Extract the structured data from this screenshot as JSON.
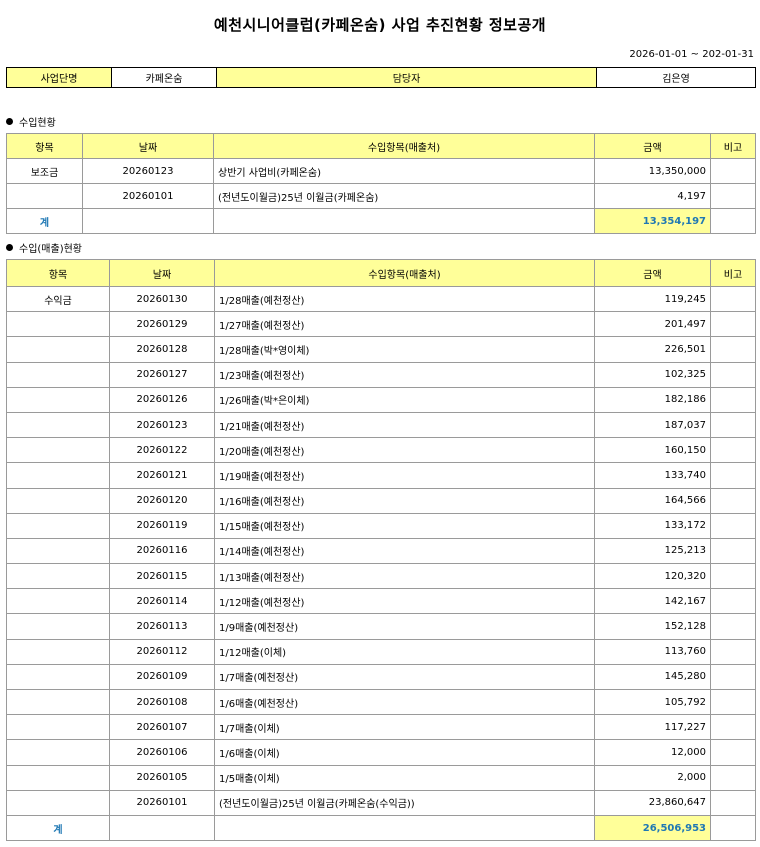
{
  "title": "예천시니어클럽(카페온숨) 사업 추진현황 정보공개",
  "period": "2026-01-01 ~ 202-01-31",
  "info": {
    "label_business": "사업단명",
    "business": "카페온숨",
    "label_manager": "담당자",
    "manager": "김은영"
  },
  "income": {
    "section": "수입현황",
    "headers": [
      "항목",
      "날짜",
      "수입항목(매출처)",
      "금액",
      "비고"
    ],
    "rows": [
      {
        "cat": "보조금",
        "date": "20260123",
        "desc": "상반기 사업비(카페온숨)",
        "amount": "13,350,000",
        "note": ""
      },
      {
        "cat": "",
        "date": "20260101",
        "desc": "(전년도이월금)25년 이월금(카페온숨)",
        "amount": "4,197",
        "note": ""
      }
    ],
    "total_label": "계",
    "total": "13,354,197"
  },
  "sales": {
    "section": "수입(매출)현황",
    "headers": [
      "항목",
      "날짜",
      "수입항목(매출처)",
      "금액",
      "비고"
    ],
    "rows": [
      {
        "cat": "수익금",
        "date": "20260130",
        "desc": "1/28매출(예천정산)",
        "amount": "119,245"
      },
      {
        "cat": "",
        "date": "20260129",
        "desc": "1/27매출(예천정산)",
        "amount": "201,497"
      },
      {
        "cat": "",
        "date": "20260128",
        "desc": "1/28매출(박*영이체)",
        "amount": "226,501"
      },
      {
        "cat": "",
        "date": "20260127",
        "desc": "1/23매출(예천정산)",
        "amount": "102,325"
      },
      {
        "cat": "",
        "date": "20260126",
        "desc": "1/26매출(박*은이체)",
        "amount": "182,186"
      },
      {
        "cat": "",
        "date": "20260123",
        "desc": "1/21매출(예천정산)",
        "amount": "187,037"
      },
      {
        "cat": "",
        "date": "20260122",
        "desc": "1/20매출(예천정산)",
        "amount": "160,150"
      },
      {
        "cat": "",
        "date": "20260121",
        "desc": "1/19매출(예천정산)",
        "amount": "133,740"
      },
      {
        "cat": "",
        "date": "20260120",
        "desc": "1/16매출(예천정산)",
        "amount": "164,566"
      },
      {
        "cat": "",
        "date": "20260119",
        "desc": "1/15매출(예천정산)",
        "amount": "133,172"
      },
      {
        "cat": "",
        "date": "20260116",
        "desc": "1/14매출(예천정산)",
        "amount": "125,213"
      },
      {
        "cat": "",
        "date": "20260115",
        "desc": "1/13매출(예천정산)",
        "amount": "120,320"
      },
      {
        "cat": "",
        "date": "20260114",
        "desc": "1/12매출(예천정산)",
        "amount": "142,167"
      },
      {
        "cat": "",
        "date": "20260113",
        "desc": "1/9매출(예천정산)",
        "amount": "152,128"
      },
      {
        "cat": "",
        "date": "20260112",
        "desc": "1/12매출(이체)",
        "amount": "113,760"
      },
      {
        "cat": "",
        "date": "20260109",
        "desc": "1/7매출(예천정산)",
        "amount": "145,280"
      },
      {
        "cat": "",
        "date": "20260108",
        "desc": "1/6매출(예천정산)",
        "amount": "105,792"
      },
      {
        "cat": "",
        "date": "20260107",
        "desc": "1/7매출(이체)",
        "amount": "117,227"
      },
      {
        "cat": "",
        "date": "20260106",
        "desc": "1/6매출(이체)",
        "amount": "12,000"
      },
      {
        "cat": "",
        "date": "20260105",
        "desc": "1/5매출(이체)",
        "amount": "2,000"
      },
      {
        "cat": "",
        "date": "20260101",
        "desc": "(전년도이월금)25년 이월금(카페온숨(수익금))",
        "amount": "23,860,647"
      }
    ],
    "total_label": "계",
    "total": "26,506,953"
  }
}
